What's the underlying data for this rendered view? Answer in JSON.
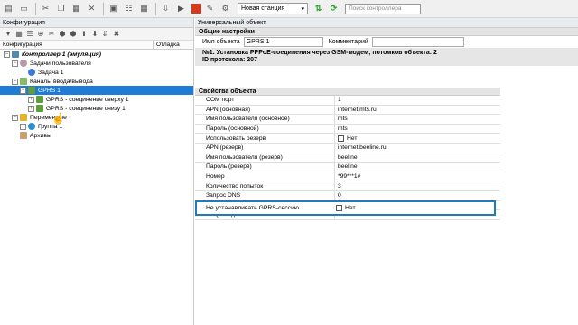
{
  "toolbar": {
    "station": "Новая станция",
    "search_placeholder": "Поиск контроллера"
  },
  "left": {
    "title": "Конфигурация",
    "columns": [
      "Конфигурация",
      "Отладка"
    ],
    "tree": {
      "controller": "Контроллер 1 (эмуляция)",
      "user_tasks": "Задачи пользователя",
      "task1": "Задача 1",
      "io_channels": "Каналы ввода/вывода",
      "gprs1": "GPRS 1",
      "gprs_top": "GPRS - соединение сверху 1",
      "gprs_bottom": "GPRS - соединение снизу 1",
      "variables": "Переменные",
      "group1": "Группа 1",
      "archives": "Архивы"
    }
  },
  "right": {
    "title": "Универсальный объект",
    "general_section": "Общие настройки",
    "name_label": "Имя объекта",
    "name_value": "GPRS 1",
    "comment_label": "Комментарий",
    "info_line1": "№1. Установка PPPoE-соединения через GSM-модем; потомков объекта: 2",
    "info_line2": "ID протокола: 207",
    "props_section": "Свойства объекта",
    "props": [
      {
        "k": "COM порт",
        "v": "1"
      },
      {
        "k": "APN (основная)",
        "v": "internet.mts.ru"
      },
      {
        "k": "Имя пользователя (основное)",
        "v": "mts"
      },
      {
        "k": "Пароль (основной)",
        "v": "mts"
      },
      {
        "k": "Использовать резерв",
        "v": "Нет",
        "checkbox": true
      },
      {
        "k": "APN (резерв)",
        "v": "internet.beeline.ru"
      },
      {
        "k": "Имя пользователя (резерв)",
        "v": "beeline"
      },
      {
        "k": "Пароль (резерв)",
        "v": "beeline"
      },
      {
        "k": "Номер",
        "v": "*99***1#"
      },
      {
        "k": "Количество попыток",
        "v": "3"
      },
      {
        "k": "Запрос DNS",
        "v": "0"
      },
      {
        "k": "Лог",
        "v": "1"
      },
      {
        "k": "CSQ ожидание",
        "v": "60"
      }
    ],
    "highlighted": {
      "k": "Не устанавливать GPRS-сессию",
      "v": "Нет"
    }
  }
}
